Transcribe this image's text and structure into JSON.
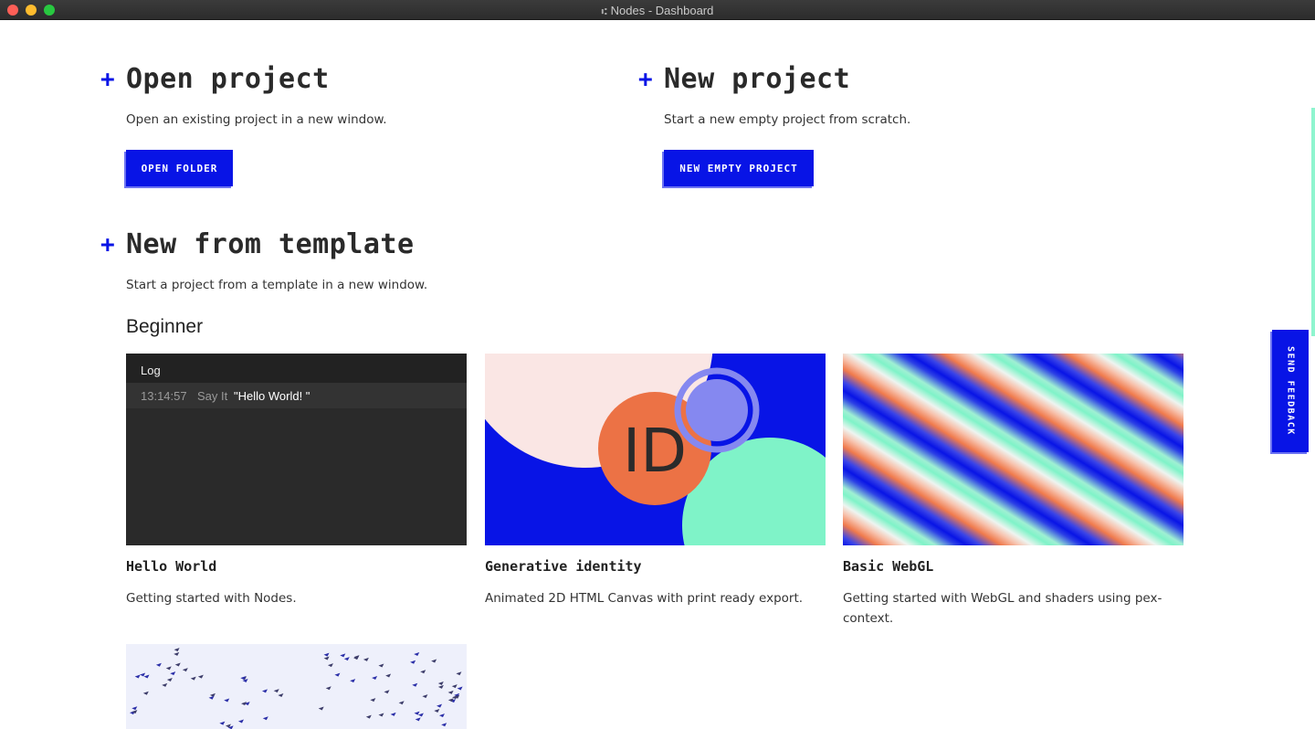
{
  "window": {
    "title": "Nodes - Dashboard",
    "app_glyph": "⑆"
  },
  "colors": {
    "accent": "#0814e6",
    "accent_shadow": "#6d74f2",
    "mint": "#7ff3c8",
    "orange": "#f07a4c",
    "log_bg": "#2a2a2a"
  },
  "open_project": {
    "plus": "+",
    "title": "Open project",
    "description": "Open an existing project in a new window.",
    "button": "OPEN FOLDER"
  },
  "new_project": {
    "plus": "+",
    "title": "New project",
    "description": "Start a new empty project from scratch.",
    "button": "NEW EMPTY PROJECT"
  },
  "template": {
    "plus": "+",
    "title": "New from template",
    "description": "Start a project from a template in a new window.",
    "group": "Beginner",
    "cards": [
      {
        "title": "Hello World",
        "description": "Getting started with Nodes.",
        "thumb": {
          "header": "Log",
          "time": "13:14:57",
          "source": "Say It",
          "message": "\"Hello World! \""
        }
      },
      {
        "title": "Generative identity",
        "description": "Animated 2D HTML Canvas with print ready export.",
        "thumb": {
          "text": "ID"
        }
      },
      {
        "title": "Basic WebGL",
        "description": "Getting started with WebGL and shaders using pex-context."
      }
    ]
  },
  "feedback": {
    "label": "SEND FEEDBACK"
  }
}
